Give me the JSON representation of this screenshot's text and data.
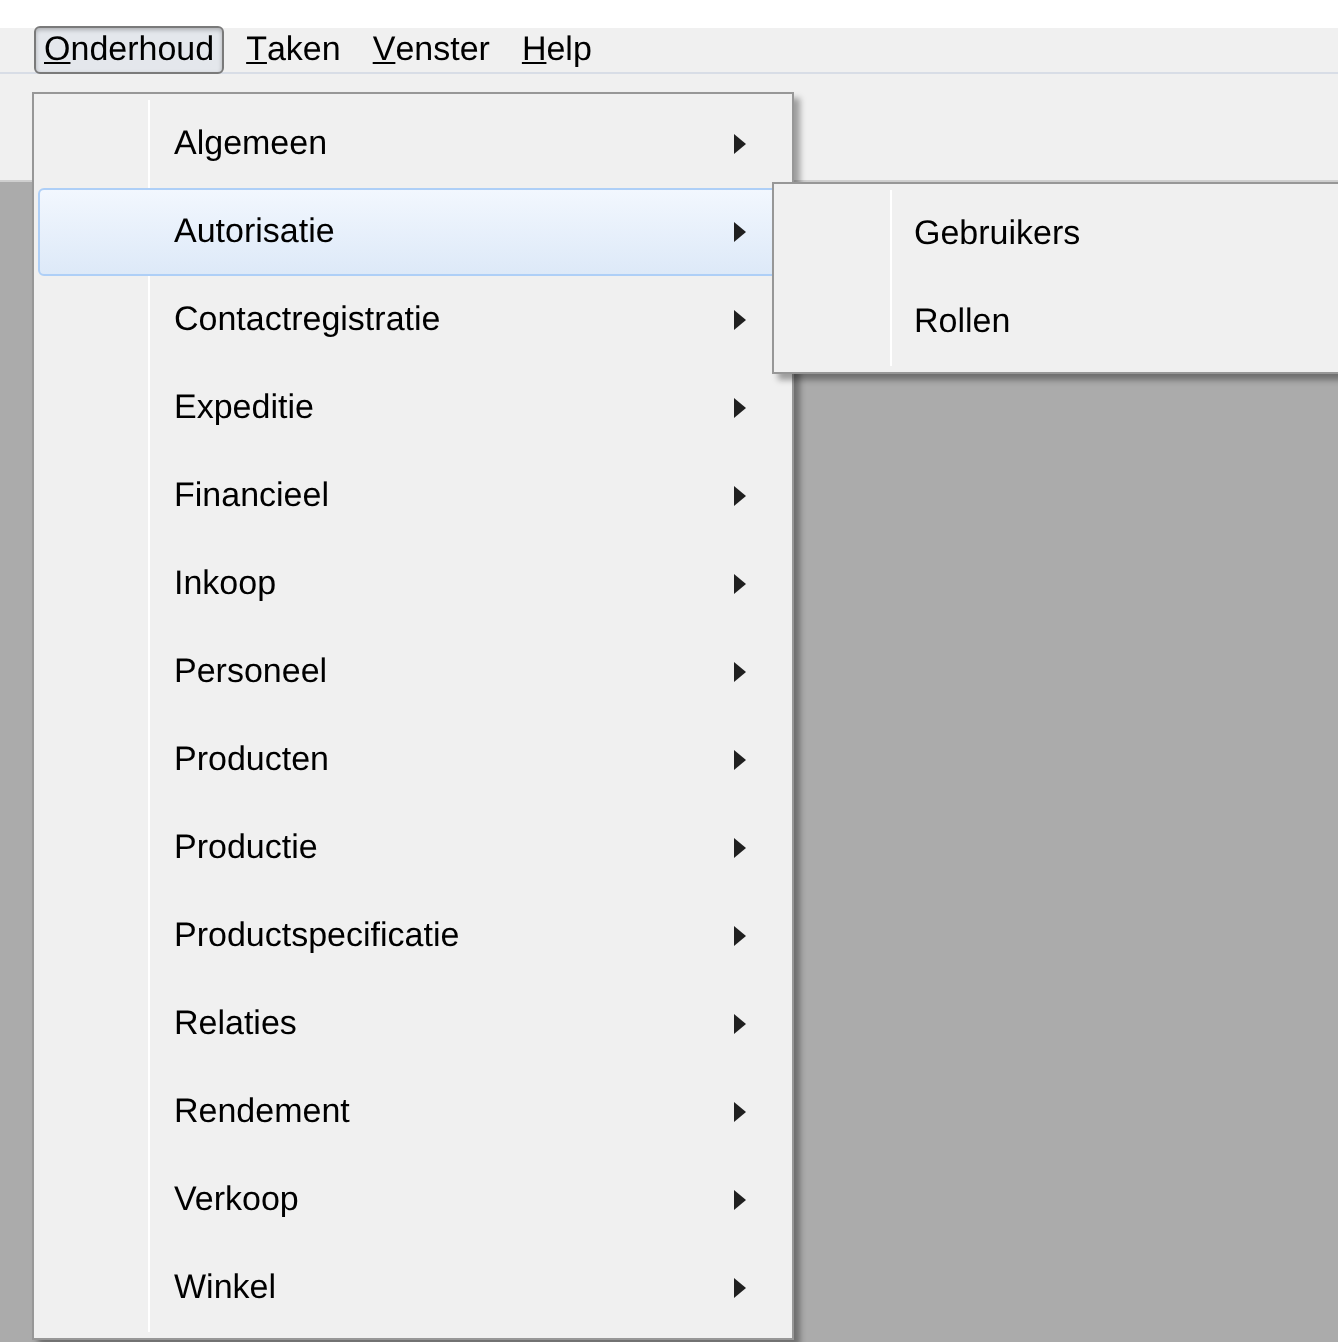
{
  "menubar": [
    {
      "label": "Onderhoud",
      "selected": true
    },
    {
      "label": "Taken",
      "selected": false
    },
    {
      "label": "Venster",
      "selected": false
    },
    {
      "label": "Help",
      "selected": false
    }
  ],
  "menu": {
    "items": [
      {
        "label": "Algemeen",
        "selected": false
      },
      {
        "label": "Autorisatie",
        "selected": true
      },
      {
        "label": "Contactregistratie",
        "selected": false
      },
      {
        "label": "Expeditie",
        "selected": false
      },
      {
        "label": "Financieel",
        "selected": false
      },
      {
        "label": "Inkoop",
        "selected": false
      },
      {
        "label": "Personeel",
        "selected": false
      },
      {
        "label": "Producten",
        "selected": false
      },
      {
        "label": "Productie",
        "selected": false
      },
      {
        "label": "Productspecificatie",
        "selected": false
      },
      {
        "label": "Relaties",
        "selected": false
      },
      {
        "label": "Rendement",
        "selected": false
      },
      {
        "label": "Verkoop",
        "selected": false
      },
      {
        "label": "Winkel",
        "selected": false
      }
    ]
  },
  "submenu": {
    "items": [
      {
        "label": "Gebruikers"
      },
      {
        "label": "Rollen"
      }
    ]
  }
}
